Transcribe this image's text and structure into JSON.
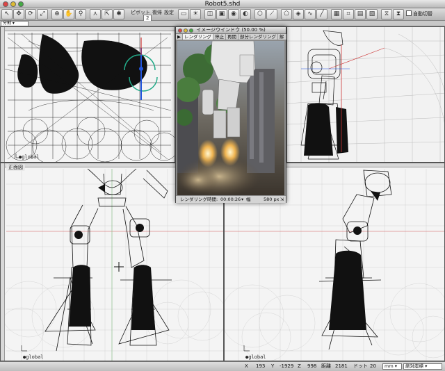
{
  "window": {
    "title": "Robot5.shd"
  },
  "toolbar": {
    "pivot_label": "ピボット",
    "restore_label": "復帰",
    "settings_label": "設定",
    "pivot_value": "2",
    "auto_switch_label": "自動切替",
    "tools": [
      "cursor-tool",
      "move-tool",
      "rotate-tool",
      "scale-tool",
      "zoom-tool",
      "pan-tool",
      "link-tool",
      "cube-tool",
      "sphere-tool",
      "light-tool",
      "camera-tool",
      "render-tool",
      "material-tool",
      "grid-tool",
      "snap-tool",
      "mirror-tool",
      "deform-tool",
      "curve-tool",
      "edit-tool"
    ]
  },
  "view_selector": {
    "value": "分割"
  },
  "panes": {
    "top_left": {
      "global_label": "global"
    },
    "front": {
      "title": "正面図",
      "global_label": "global"
    },
    "right": {
      "global_label": "global"
    }
  },
  "image_window": {
    "title": "イメージウインドウ (50.00 %)",
    "tabs": [
      "レンダリング",
      "停止",
      "再開",
      "部分レンダリング",
      "解"
    ],
    "render_time_label": "レンダリング時間:",
    "render_time": "00:00:26",
    "width_label": "幅",
    "width_value": "580 px"
  },
  "status": {
    "x_label": "X",
    "x_value": "193",
    "y_label": "Y",
    "y_value": "-1929",
    "z_label": "Z",
    "z_value": "998",
    "distance_label": "距離",
    "distance_value": "2181",
    "dot_label": "ドット",
    "dot_value": "20",
    "unit": "mm",
    "coord_mode": "絶対座標"
  }
}
